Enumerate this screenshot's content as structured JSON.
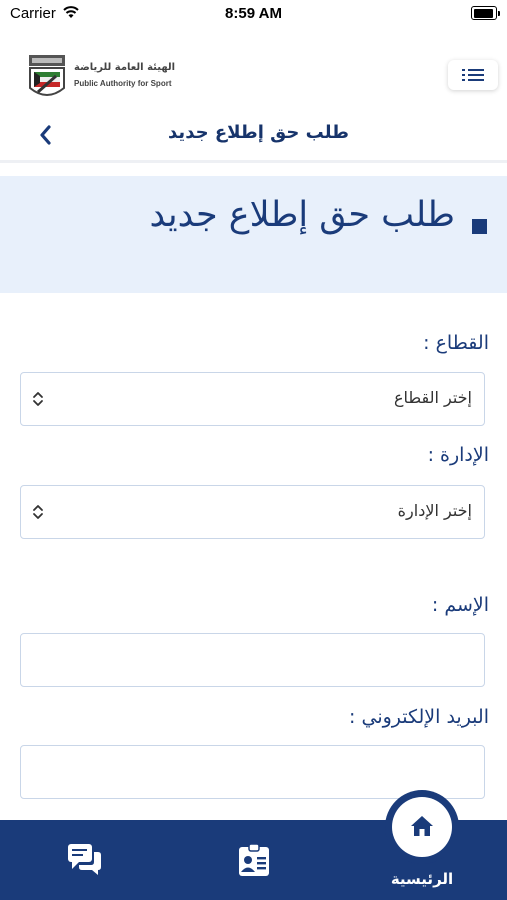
{
  "status_bar": {
    "carrier": "Carrier",
    "time": "8:59 AM"
  },
  "logo": {
    "name_ar": "الهيئة العامة للرياضة",
    "name_en": "Public Authority for Sport"
  },
  "header": {
    "title": "طلب حق إطلاع جديد"
  },
  "banner": {
    "title": "طلب حق إطلاع جديد"
  },
  "form": {
    "sector": {
      "label": "القطاع :",
      "selected": "إختر القطاع"
    },
    "department": {
      "label": "الإدارة :",
      "selected": "إختر الإدارة"
    },
    "name": {
      "label": "الإسم :",
      "value": ""
    },
    "email": {
      "label": "البريد الإلكتروني :",
      "value": ""
    }
  },
  "bottom_nav": {
    "home_label": "الرئيسية"
  },
  "colors": {
    "primary": "#1a3b7a",
    "banner_bg": "#e8f0fb",
    "field_border": "#c9d6e8"
  }
}
